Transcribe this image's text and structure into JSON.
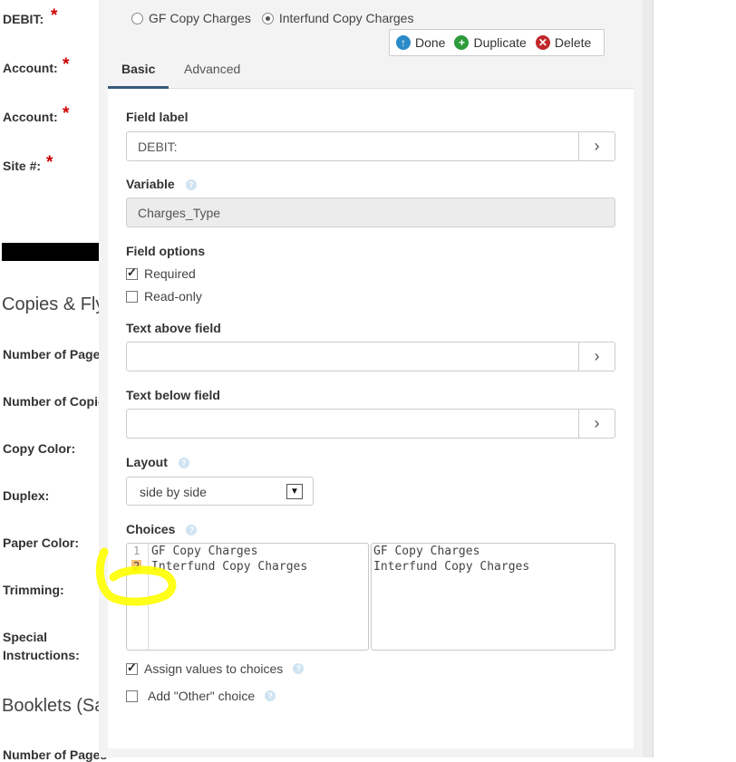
{
  "form": {
    "debit_label": "DEBIT:",
    "account_label_1": "Account:",
    "account_label_2": "Account:",
    "site_label": "Site #:",
    "required_mark": "*",
    "section_copies": "Copies & Fly",
    "number_of_pages": "Number of Page",
    "number_of_copies": "Number of Copie",
    "copy_color": "Copy Color:",
    "duplex": "Duplex:",
    "paper_color": "Paper Color:",
    "trimming": "Trimming:",
    "special_instructions_1": "Special",
    "special_instructions_2": "Instructions:",
    "section_booklets": "Booklets (Sa",
    "number_of_pages_2": "Number of Pages"
  },
  "debit_radios": {
    "option_1": "GF Copy Charges",
    "option_2": "Interfund Copy Charges",
    "selected": "Interfund Copy Charges"
  },
  "toolbar": {
    "done": "Done",
    "duplicate": "Duplicate",
    "delete": "Delete"
  },
  "tabs": {
    "basic": "Basic",
    "advanced": "Advanced",
    "active": "Basic"
  },
  "editor": {
    "field_label_heading": "Field label",
    "field_label_value": "DEBIT:",
    "variable_heading": "Variable",
    "variable_value": "Charges_Type",
    "field_options_heading": "Field options",
    "required_label": "Required",
    "required_checked": true,
    "readonly_label": "Read-only",
    "readonly_checked": false,
    "text_above_heading": "Text above field",
    "text_above_value": "",
    "text_below_heading": "Text below field",
    "text_below_value": "",
    "layout_heading": "Layout",
    "layout_value": "side by side",
    "choices_heading": "Choices",
    "choices_lines": [
      "GF Copy Charges",
      "Interfund Copy Charges"
    ],
    "line_numbers": [
      "1",
      "2"
    ],
    "values_lines": [
      "GF Copy Charges",
      "Interfund Copy Charges"
    ],
    "assign_values_label": "Assign values to choices",
    "assign_values_checked": true,
    "add_other_label": "Add \"Other\" choice",
    "add_other_checked": false,
    "help_icon": "?",
    "arrow_glyph": "›"
  },
  "colors": {
    "required": "#cc0000",
    "highlight_marker": "#ffff00",
    "line_highlight": "#f7c17a",
    "done_icon": "#2b8ac8",
    "duplicate_icon": "#2e9b3a",
    "delete_icon": "#c0262a"
  }
}
